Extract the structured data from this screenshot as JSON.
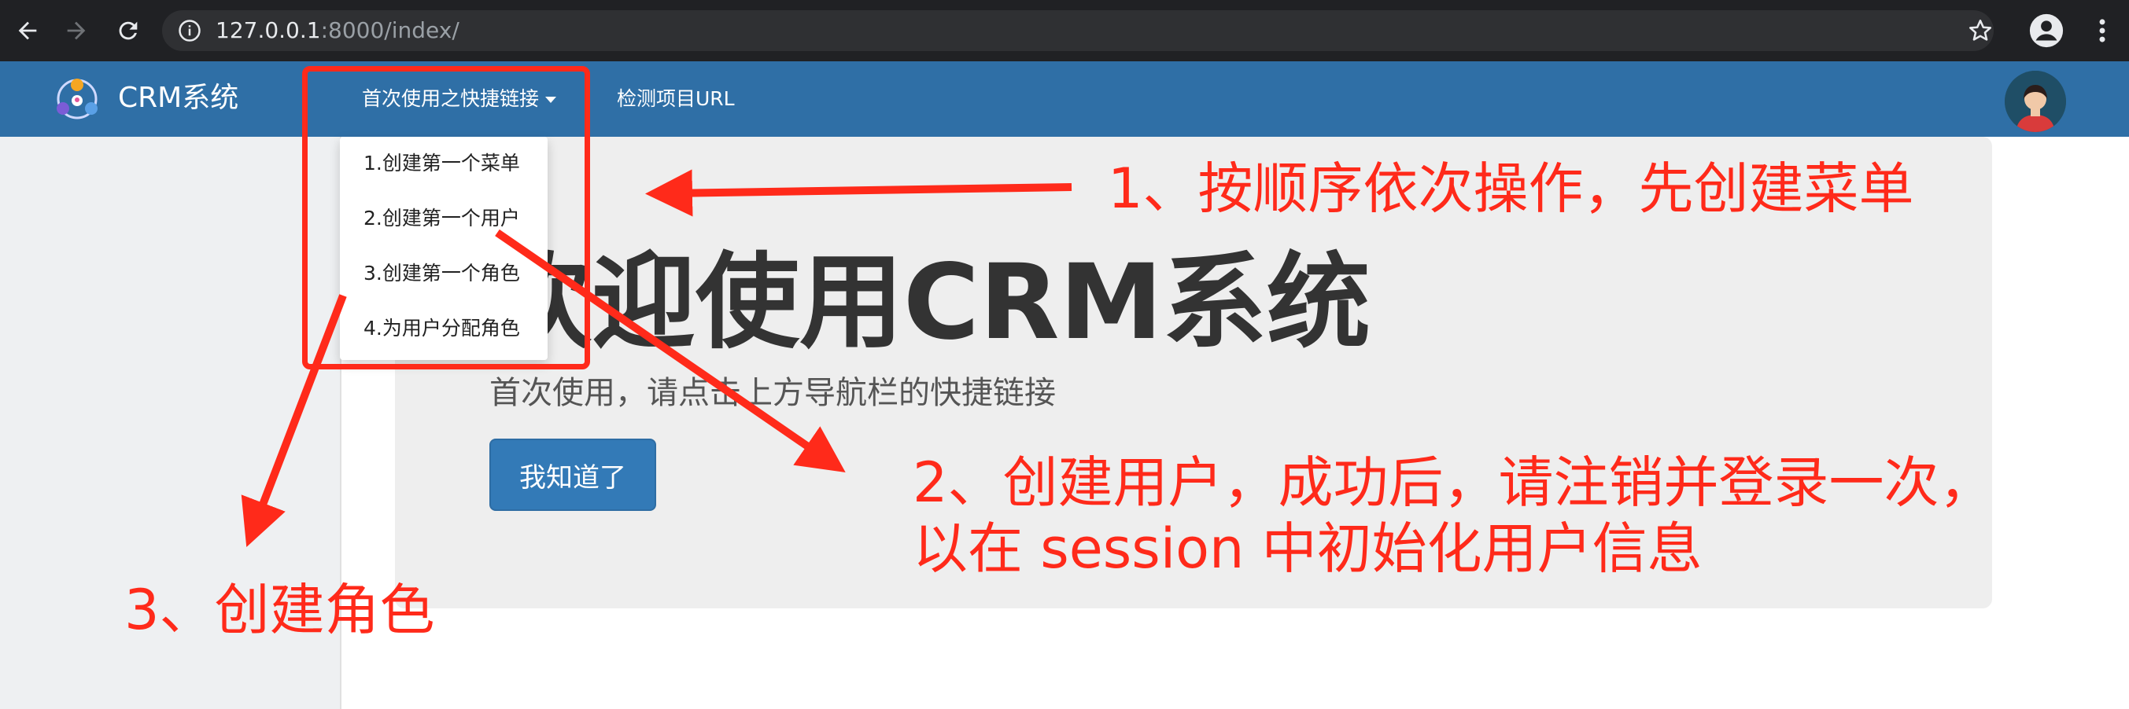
{
  "browser": {
    "url_host": "127.0.0.1",
    "url_rest": ":8000/index/",
    "icons": [
      "back-arrow-icon",
      "forward-arrow-icon",
      "reload-icon",
      "info-icon",
      "star-icon",
      "profile-icon",
      "more-icon"
    ]
  },
  "navbar": {
    "brand": "CRM系统",
    "quick_links": "首次使用之快捷链接",
    "detect_url": "检测项目URL"
  },
  "dropdown": {
    "items": [
      "1.创建第一个菜单",
      "2.创建第一个用户",
      "3.创建第一个角色",
      "4.为用户分配角色"
    ]
  },
  "jumbotron": {
    "title": "欢迎使用CRM系统",
    "subtitle": "首次使用，请点击上方导航栏的快捷链接",
    "button": "我知道了"
  },
  "annotations": {
    "note1": "1、按顺序依次操作，先创建菜单",
    "note2_line1": "2、创建用户，成功后，请注销并登录一次，",
    "note2_line2": "以在 session 中初始化用户信息",
    "note3": "3、创建角色"
  },
  "colors": {
    "navbar": "#2f6fa6",
    "annotation": "#ff2a1a",
    "button": "#337ab7"
  }
}
